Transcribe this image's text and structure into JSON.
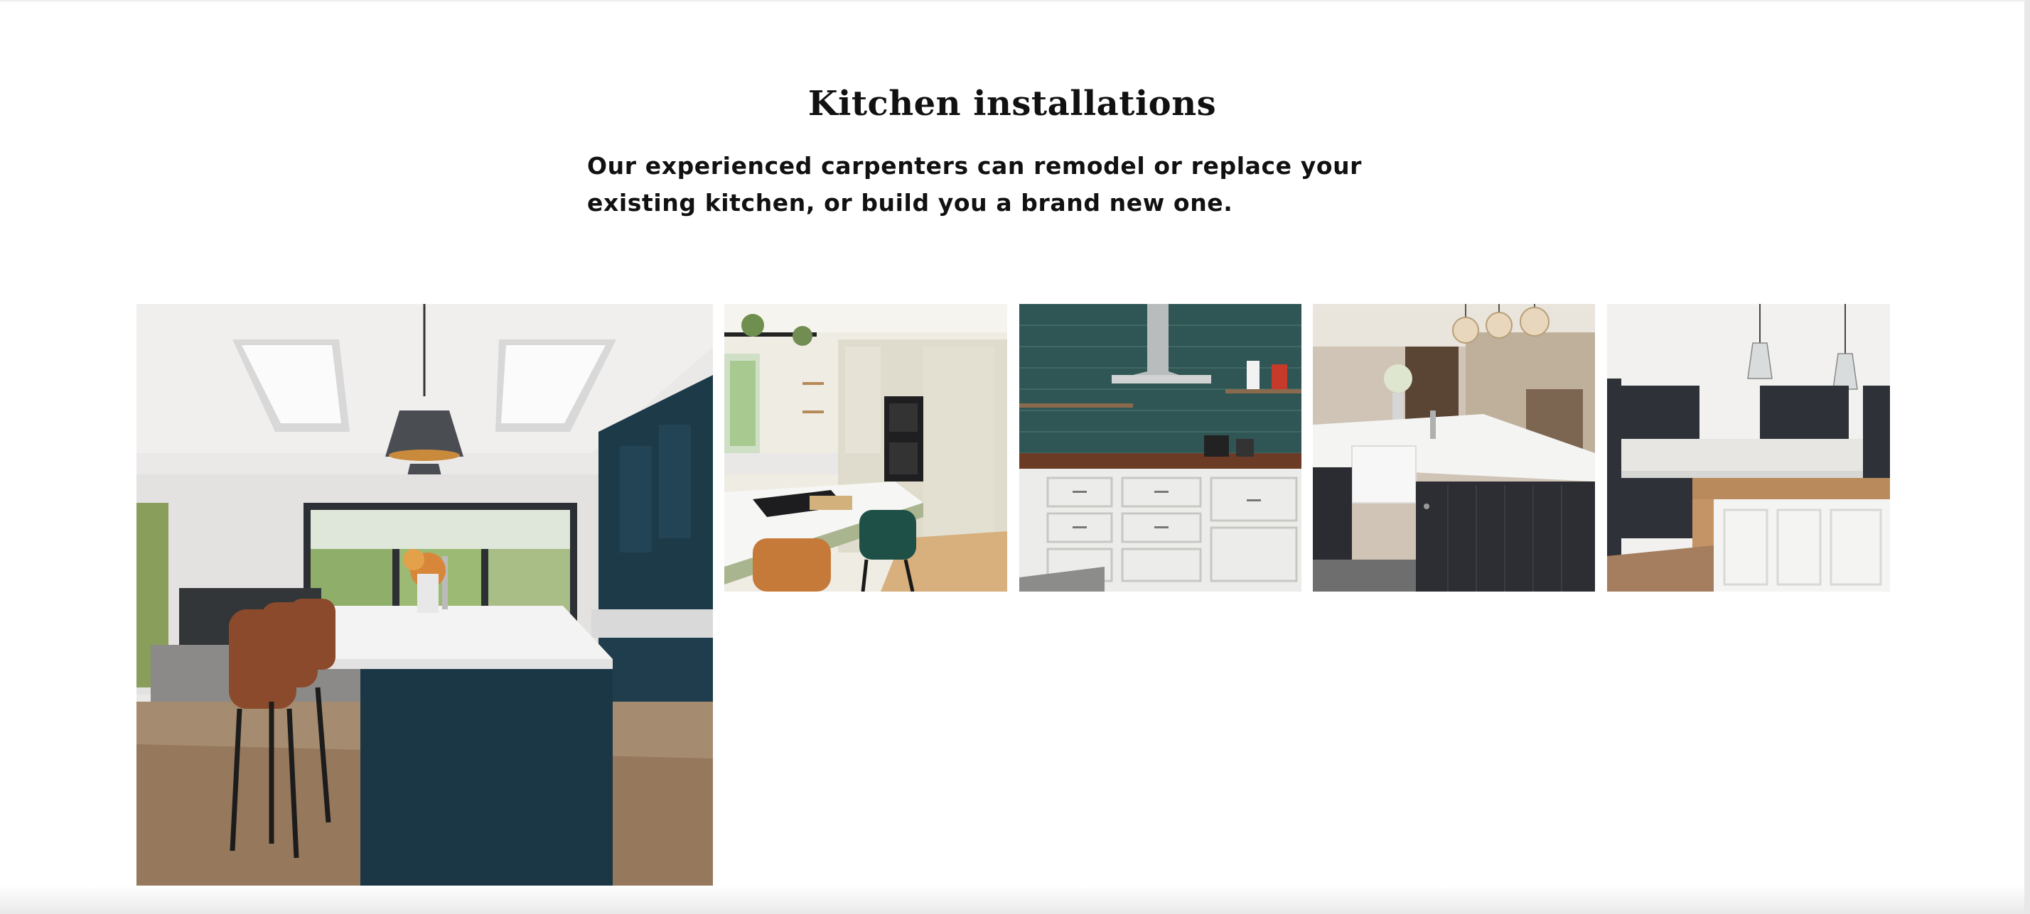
{
  "section": {
    "title": "Kitchen installations",
    "intro": "Our experienced carpenters can remodel or replace your existing kitchen, or build you a brand new one."
  },
  "gallery": {
    "photos": [
      "kitchen-photo-navy-island-skylights",
      "kitchen-photo-sage-cabinets-orange-stools",
      "kitchen-photo-green-tile-splashback",
      "kitchen-photo-belfast-sink-island",
      "kitchen-photo-dark-cabinets-wood-island"
    ]
  },
  "colors": {
    "text": "#111111",
    "background": "#ffffff"
  }
}
